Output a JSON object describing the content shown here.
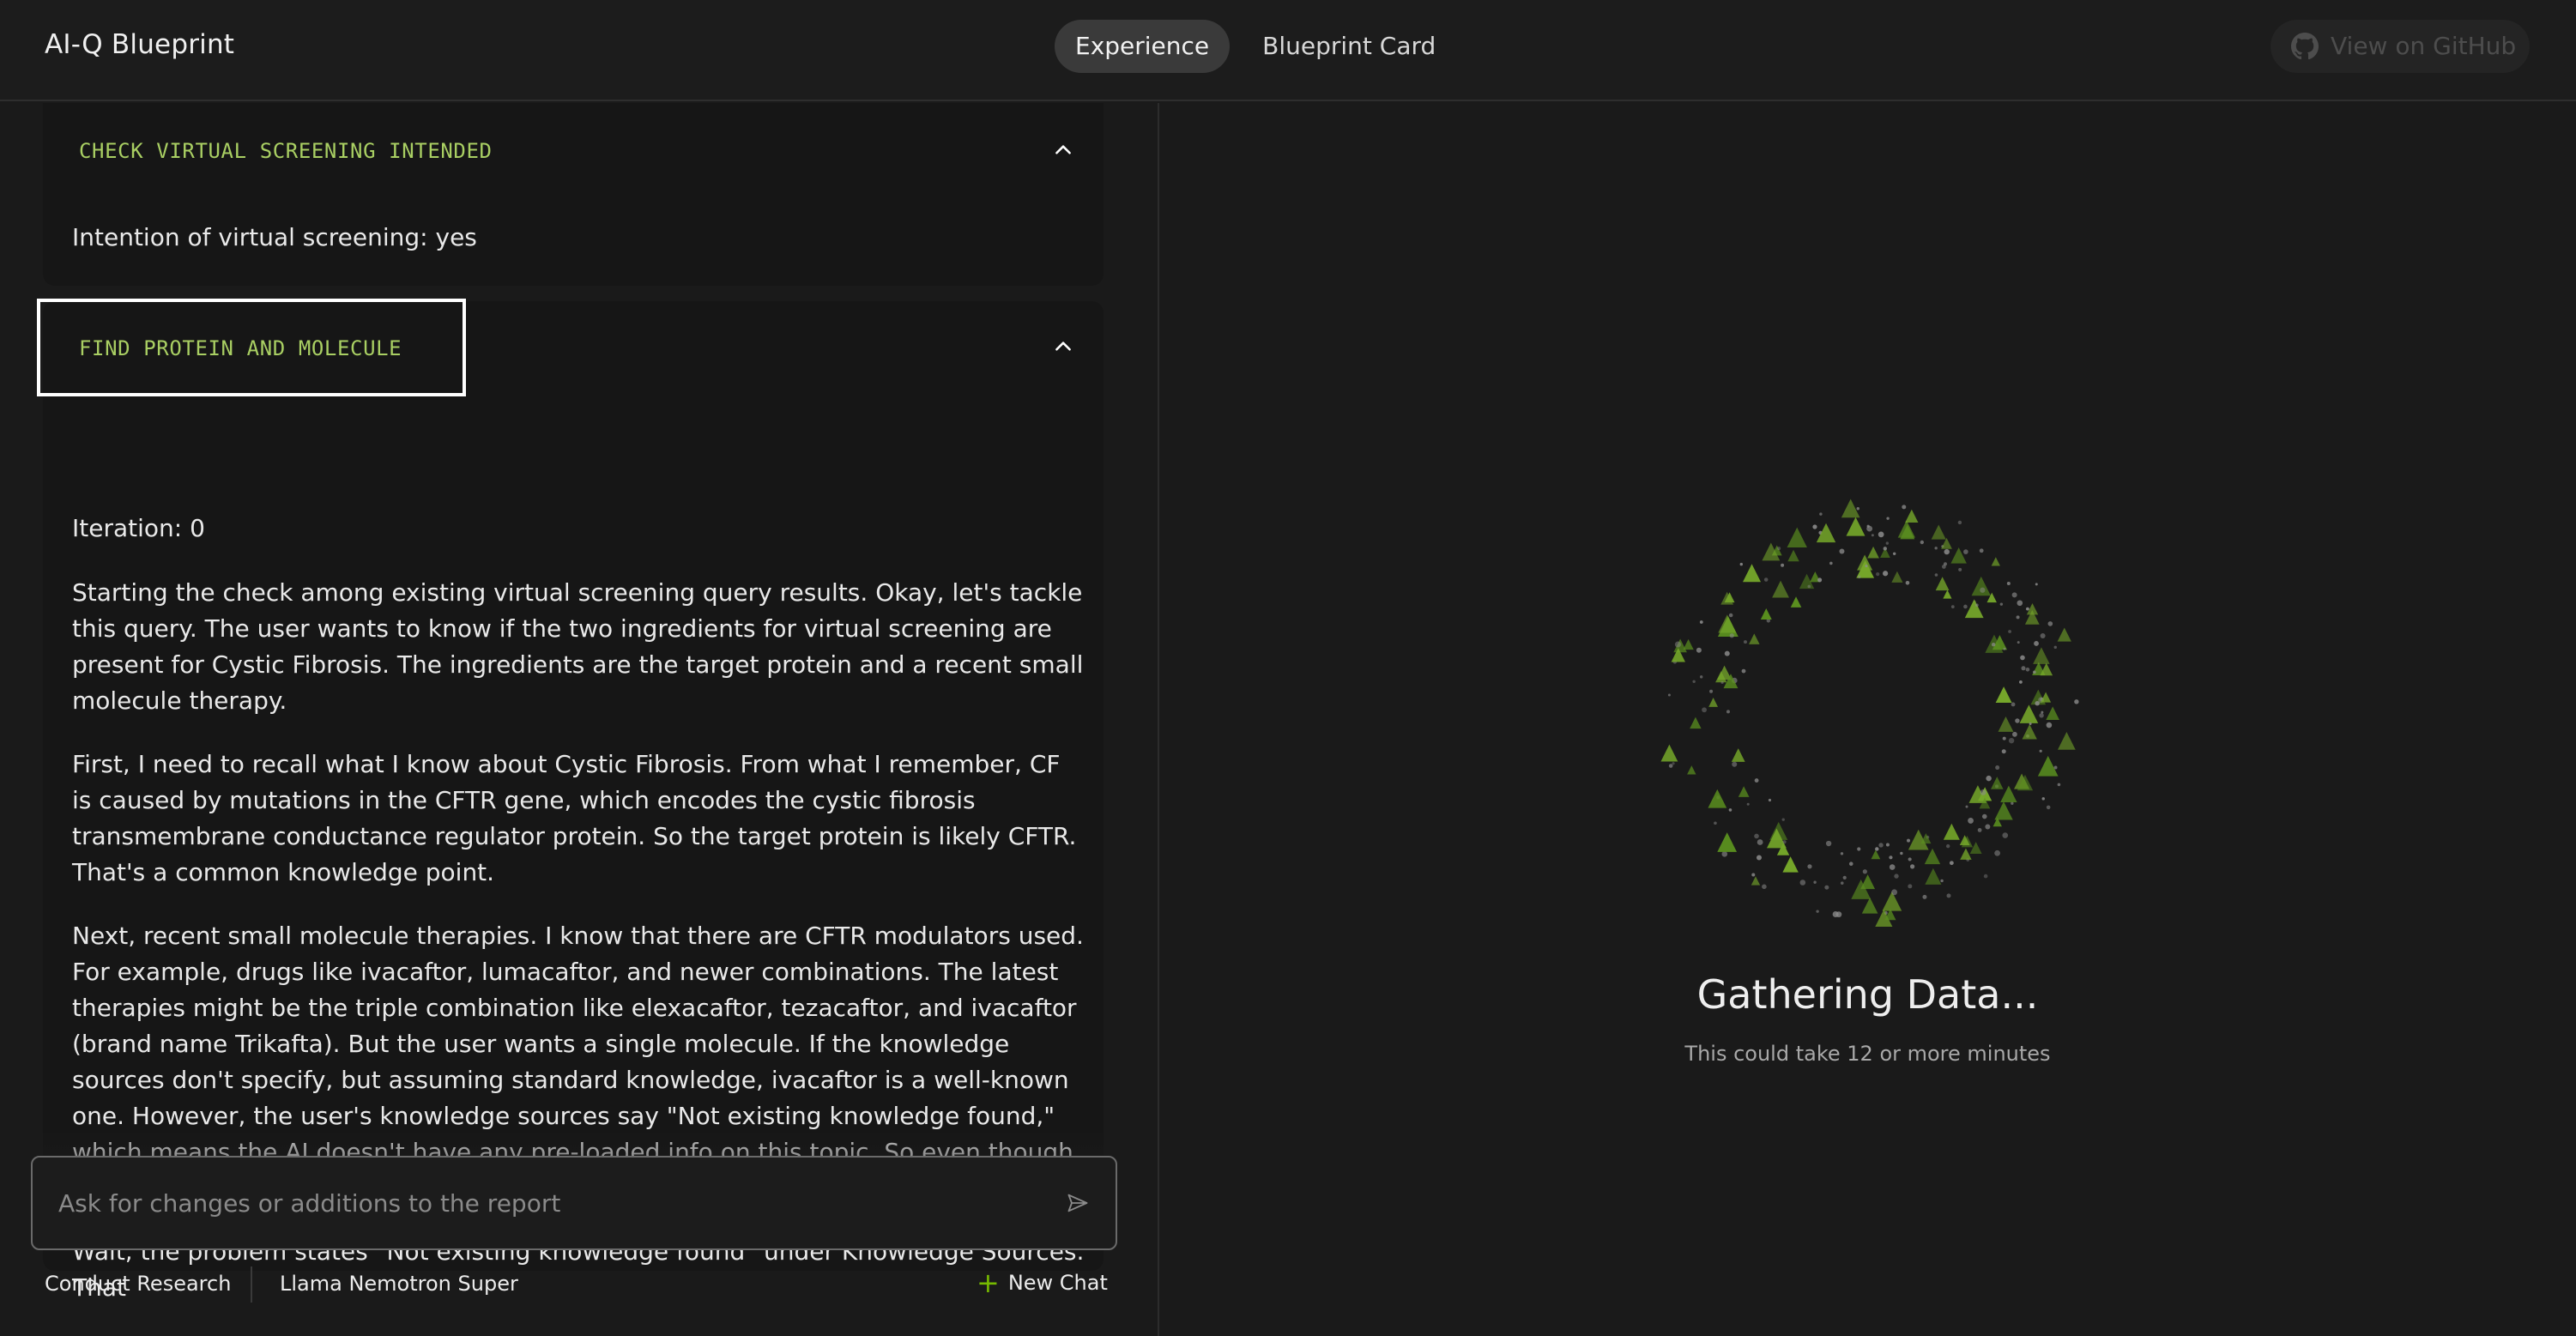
{
  "header": {
    "app_title": "AI-Q Blueprint",
    "tabs": [
      {
        "label": "Experience",
        "active": true
      },
      {
        "label": "Blueprint Card",
        "active": false
      }
    ],
    "github_button": "View on GitHub"
  },
  "steps": [
    {
      "title": "CHECK VIRTUAL SCREENING INTENDED",
      "expanded": true,
      "text": "Intention of virtual screening: yes"
    },
    {
      "title": "FIND PROTEIN AND MOLECULE",
      "expanded": true,
      "iteration": "Iteration: 0",
      "paragraphs": [
        "Starting the check among existing virtual screening query results. Okay, let's tackle this query. The user wants to know if the two ingredients for virtual screening are present for Cystic Fibrosis. The ingredients are the target protein and a recent small molecule therapy.",
        "First, I need to recall what I know about Cystic Fibrosis. From what I remember, CF is caused by mutations in the CFTR gene, which encodes the cystic fibrosis transmembrane conductance regulator protein. So the target protein is likely CFTR. That's a common knowledge point.",
        "Next, recent small molecule therapies. I know that there are CFTR modulators used. For example, drugs like ivacaftor, lumacaftor, and newer combinations. The latest therapies might be the triple combination like elexacaftor, tezacaftor, and ivacaftor (brand name Trikafta). But the user wants a single molecule. If the knowledge sources don't specify, but assuming standard knowledge, ivacaftor is a well-known one. However, the user's knowledge sources say \"Not existing knowledge found,\" which means the AI doesn't have any pre-loaded info on this topic. So even though I know this, the system's knowledge base here is empty.",
        "Wait, the problem states \"Not existing knowledge found\" under Knowledge Sources. That"
      ]
    }
  ],
  "input": {
    "placeholder": "Ask for changes or additions to the report",
    "value": ""
  },
  "footer": {
    "mode": "Conduct Research",
    "model": "Llama Nemotron Super",
    "new_chat": "New Chat"
  },
  "status": {
    "title": "Gathering Data...",
    "subtitle": "This could take 12 or more minutes"
  },
  "colors": {
    "accent_green": "#76b900",
    "step_title": "#a9cf63",
    "background": "#1a1a1a"
  }
}
